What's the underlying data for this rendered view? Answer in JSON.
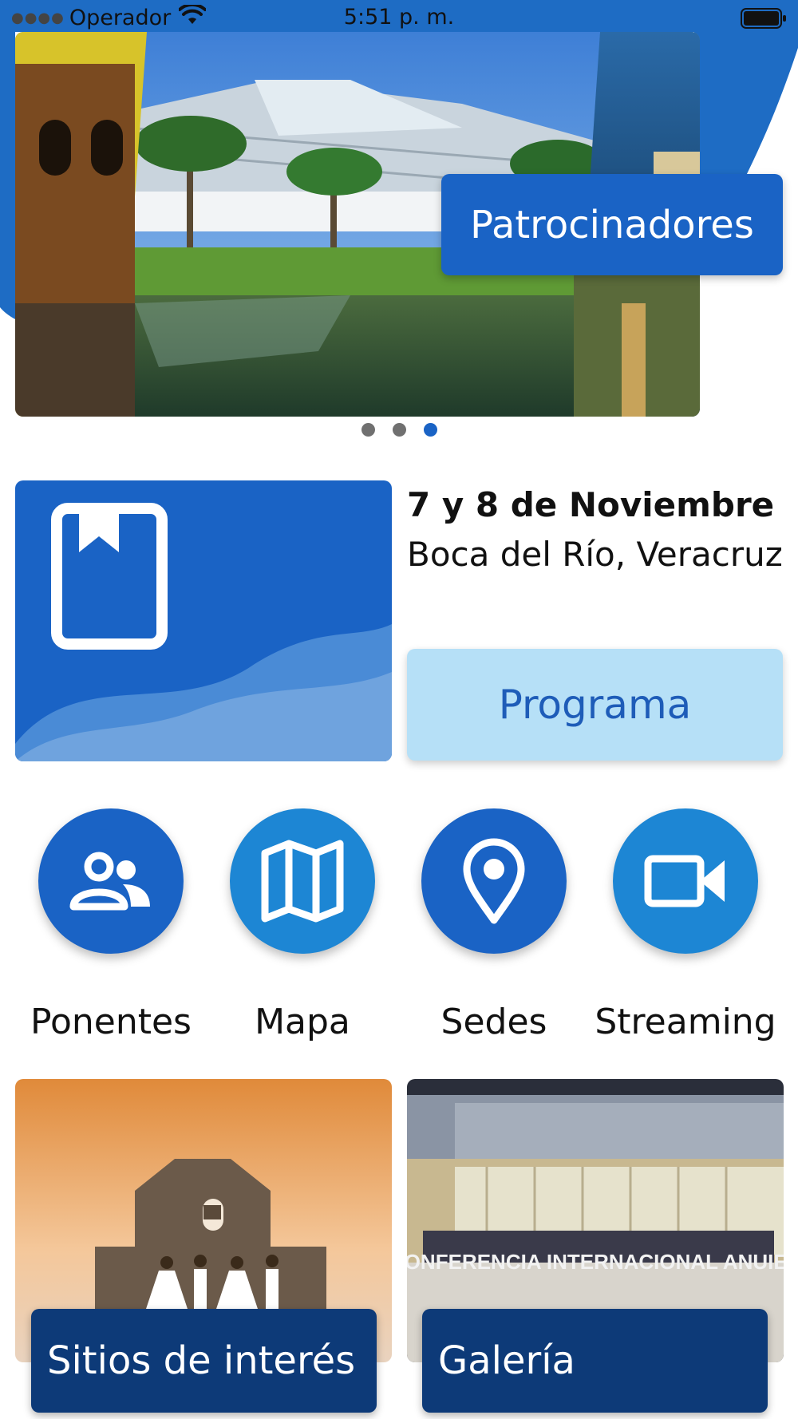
{
  "status_bar": {
    "carrier": "Operador",
    "time": "5:51 p. m."
  },
  "carousel": {
    "sponsor_button": "Patrocinadores",
    "pages": 3,
    "active_page": 3
  },
  "event": {
    "date": "7 y 8 de Noviembre",
    "location": "Boca del Río, Veracruz",
    "program_button": "Programa"
  },
  "menu": {
    "items": [
      {
        "label": "Ponentes",
        "icon": "people-icon"
      },
      {
        "label": "Mapa",
        "icon": "map-icon"
      },
      {
        "label": "Sedes",
        "icon": "location-pin-icon"
      },
      {
        "label": "Streaming",
        "icon": "video-camera-icon"
      }
    ]
  },
  "tiles": {
    "sites_label": "Sitios de interés",
    "gallery_label": "Galería",
    "gallery_banner_text": "CONFERENCIA INTERNACIONAL ANUIES"
  },
  "colors": {
    "primary": "#1a63c5",
    "secondary": "#1d86d4",
    "light": "#b6e0f7",
    "dark": "#0d3a78"
  }
}
